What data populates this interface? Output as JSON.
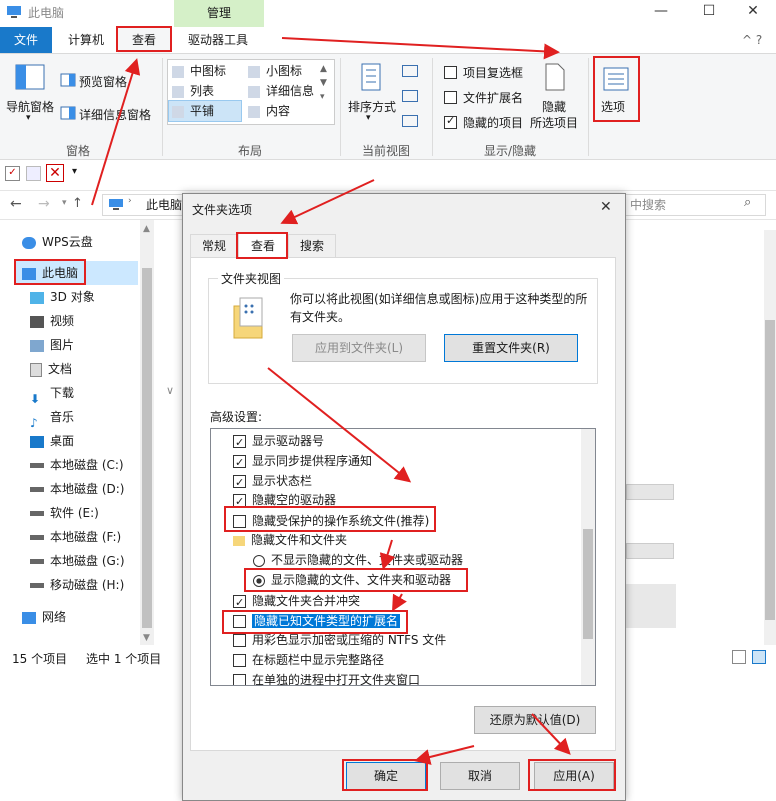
{
  "window": {
    "title": "此电脑",
    "manage_label": "管理"
  },
  "tabs": {
    "file": "文件",
    "computer": "计算机",
    "view": "查看",
    "drive_tools": "驱动器工具"
  },
  "ribbon": {
    "pane_group": {
      "nav_pane": "导航窗格",
      "preview_pane": "预览窗格",
      "details_pane": "详细信息窗格",
      "label": "窗格"
    },
    "layout_group": {
      "medium_icons": "中图标",
      "small_icons": "小图标",
      "list": "列表",
      "details": "详细信息",
      "tiles": "平铺",
      "content": "内容",
      "label": "布局"
    },
    "view_group": {
      "sort": "排序方式",
      "label": "当前视图"
    },
    "show_group": {
      "item_checkbox": "项目复选框",
      "file_ext": "文件扩展名",
      "hidden_items": "隐藏的项目",
      "hide_selected": "隐藏",
      "hide_selected2": "所选项目",
      "label": "显示/隐藏"
    },
    "options": "选项"
  },
  "address": {
    "path": "此电脑",
    "search_placeholder": "中搜索"
  },
  "nav": [
    "WPS云盘",
    "此电脑",
    "3D 对象",
    "视频",
    "图片",
    "文档",
    "下载",
    "音乐",
    "桌面",
    "本地磁盘 (C:)",
    "本地磁盘 (D:)",
    "软件 (E:)",
    "本地磁盘 (F:)",
    "本地磁盘 (G:)",
    "移动磁盘 (H:)",
    "网络"
  ],
  "status": {
    "count": "15 个项目",
    "selected": "选中 1 个项目"
  },
  "dialog": {
    "title": "文件夹选项",
    "tabs": [
      "常规",
      "查看",
      "搜索"
    ],
    "folder_view": {
      "label": "文件夹视图",
      "desc": "你可以将此视图(如详细信息或图标)应用于这种类型的所有文件夹。",
      "apply": "应用到文件夹(L)",
      "reset": "重置文件夹(R)"
    },
    "advanced_label": "高级设置:",
    "items": [
      "显示驱动器号",
      "显示同步提供程序通知",
      "显示状态栏",
      "隐藏空的驱动器",
      "隐藏受保护的操作系统文件(推荐)",
      "隐藏文件和文件夹",
      "不显示隐藏的文件、文件夹或驱动器",
      "显示隐藏的文件、文件夹和驱动器",
      "隐藏文件夹合并冲突",
      "隐藏已知文件类型的扩展名",
      "用彩色显示加密或压缩的 NTFS 文件",
      "在标题栏中显示完整路径",
      "在单独的进程中打开文件夹窗口"
    ],
    "restore": "还原为默认值(D)",
    "ok": "确定",
    "cancel": "取消",
    "apply": "应用(A)"
  }
}
